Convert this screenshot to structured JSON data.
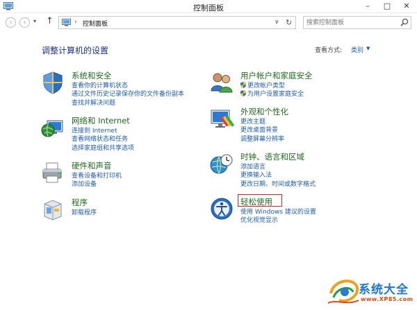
{
  "window": {
    "title": "控制面板",
    "minimize": "–",
    "maximize": "□",
    "close": "✕"
  },
  "nav": {
    "back": "‹",
    "forward": "›",
    "history": "▾",
    "up": "↑",
    "separator": "›",
    "breadcrumb": "控制面板",
    "dropdown": "∨",
    "refresh": "↻",
    "search_placeholder": "搜索控制面板"
  },
  "main": {
    "heading": "调整计算机的设置",
    "view_by_label": "查看方式:",
    "view_by_value": "类别",
    "view_by_arrow": "▼"
  },
  "categories": [
    {
      "title": "系统和安全",
      "links": [
        "查看你的计算机状态",
        "通过文件历史记录保存你的文件备份副本",
        "查找并解决问题"
      ]
    },
    {
      "title": "网络和 Internet",
      "links": [
        "连接到 Internet",
        "查看网络状态和任务",
        "选择家庭组和共享选项"
      ]
    },
    {
      "title": "硬件和声音",
      "links": [
        "查看设备和打印机",
        "添加设备"
      ]
    },
    {
      "title": "程序",
      "links": [
        "卸载程序"
      ]
    },
    {
      "title": "用户帐户和家庭安全",
      "links": [
        "更改帐户类型",
        "为用户设置家庭安全"
      ]
    },
    {
      "title": "外观和个性化",
      "links": [
        "更改主题",
        "更改桌面背景",
        "调整屏幕分辨率"
      ]
    },
    {
      "title": "时钟、语言和区域",
      "links": [
        "添加语言",
        "更换输入法",
        "更改日期、时间或数字格式"
      ]
    },
    {
      "title": "轻松使用",
      "links": [
        "使用 Windows 建议的设置",
        "优化视觉显示"
      ]
    }
  ],
  "watermark": {
    "text": "系统大全",
    "url": "www.XP85.com"
  },
  "colors": {
    "heading": "#1e3287",
    "category_title": "#1f6a1f",
    "link": "#1e5cb3",
    "highlight": "#e02020"
  }
}
